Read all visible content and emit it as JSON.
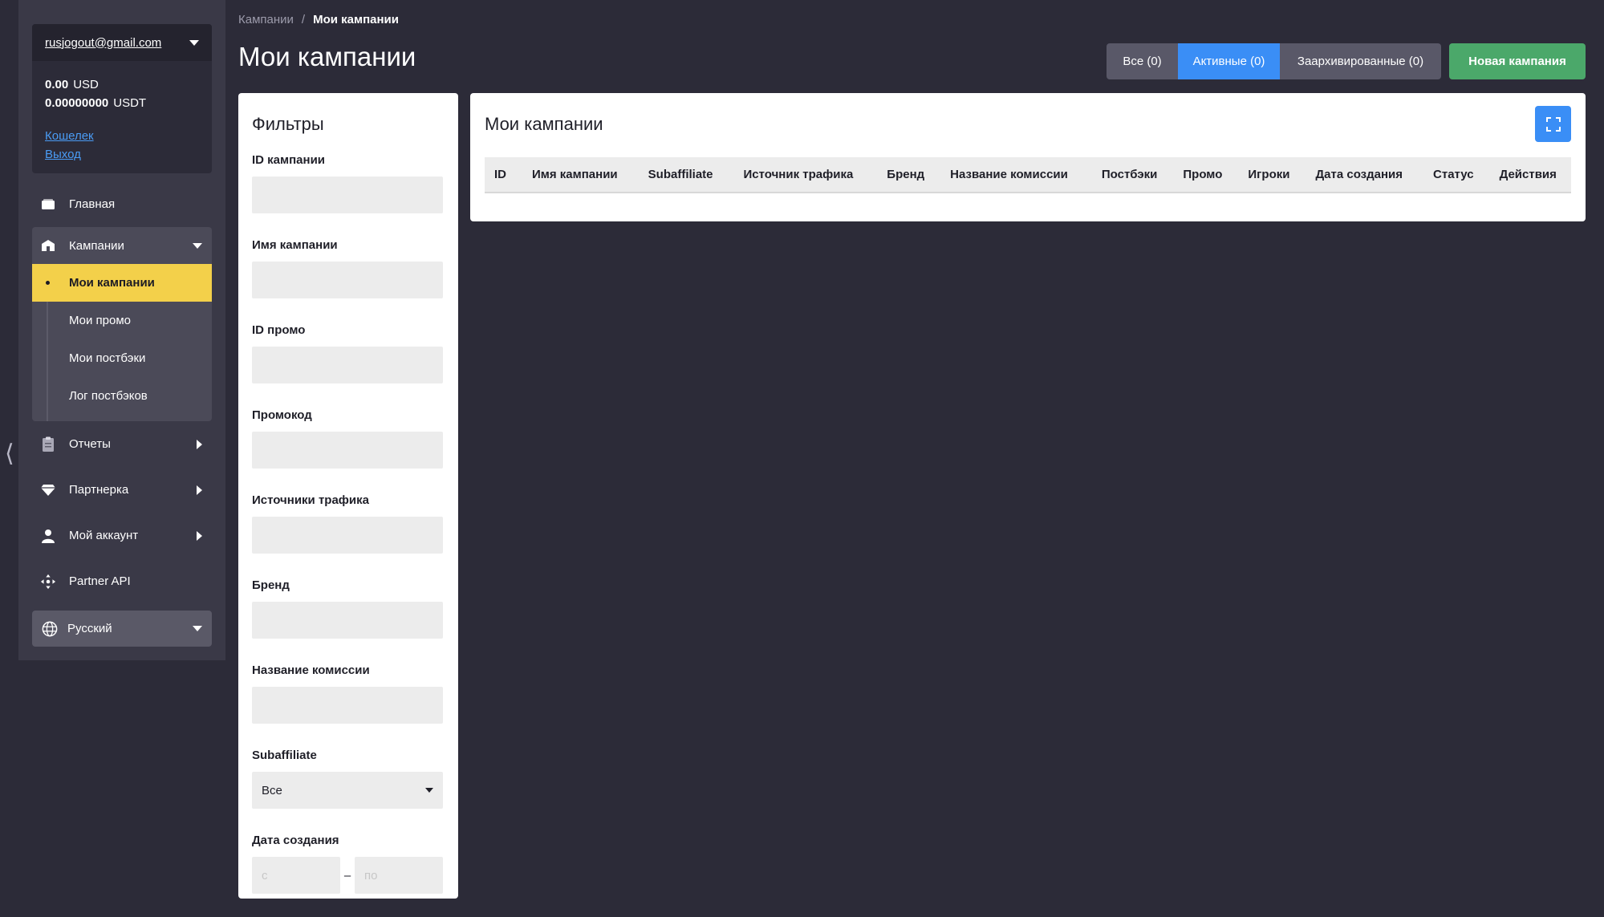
{
  "account": {
    "email": "rusjogout@gmail.com",
    "balances": [
      {
        "amount": "0.00",
        "currency": "USD"
      },
      {
        "amount": "0.00000000",
        "currency": "USDT"
      }
    ],
    "wallet_link": "Кошелек",
    "logout_link": "Выход"
  },
  "nav": {
    "home": "Главная",
    "campaigns": "Кампании",
    "campaigns_sub": [
      "Мои кампании",
      "Мои промо",
      "Мои постбэки",
      "Лог постбэков"
    ],
    "reports": "Отчеты",
    "partner": "Партнерка",
    "my_account": "Мой аккаунт",
    "partner_api": "Partner API",
    "language": "Русский"
  },
  "breadcrumb": {
    "parent": "Кампании",
    "separator": "/",
    "current": "Мои кампании"
  },
  "page": {
    "title": "Мои кампании"
  },
  "tabs": {
    "all": "Все (0)",
    "active": "Активные (0)",
    "archived": "Заархивированные (0)",
    "selected": "active"
  },
  "new_campaign_button": "Новая кампания",
  "filters": {
    "title": "Фильтры",
    "campaign_id": "ID кампании",
    "campaign_name": "Имя кампании",
    "promo_id": "ID промо",
    "promocode": "Промокод",
    "traffic_sources": "Источники трафика",
    "brand": "Бренд",
    "commission_name": "Название комиссии",
    "subaffiliate": "Subaffiliate",
    "subaffiliate_value": "Все",
    "created_date": "Дата создания",
    "date_from_placeholder": "с",
    "date_separator": "–",
    "date_to_placeholder": "по"
  },
  "table": {
    "title": "Мои кампании",
    "columns": [
      "ID",
      "Имя кампании",
      "Subaffiliate",
      "Источник трафика",
      "Бренд",
      "Название комиссии",
      "Постбэки",
      "Промо",
      "Игроки",
      "Дата создания",
      "Статус",
      "Действия"
    ]
  }
}
